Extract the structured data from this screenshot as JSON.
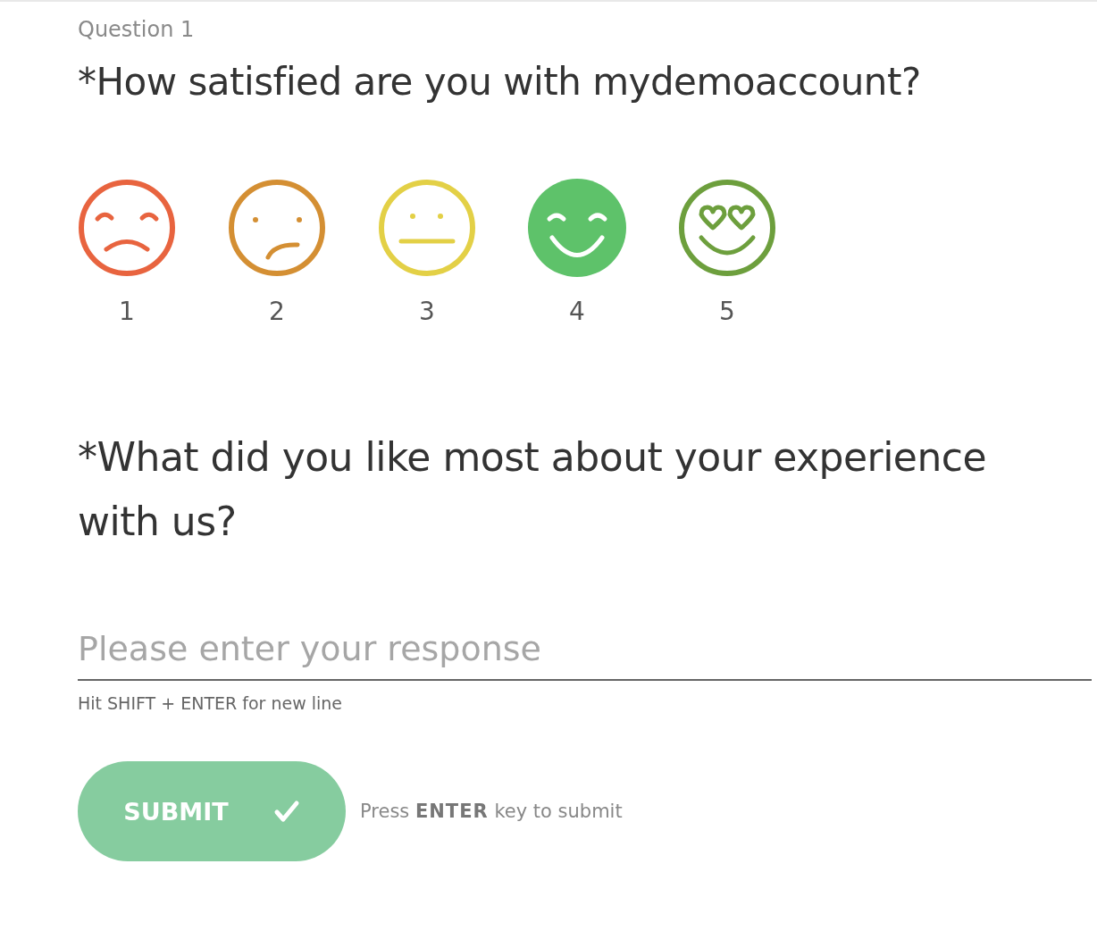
{
  "question_label": "Question 1",
  "question_1": "*How satisfied are you with mydemoaccount?",
  "ratings": [
    {
      "label": "1",
      "kind": "sad",
      "color": "#e8643f",
      "selected": false
    },
    {
      "label": "2",
      "kind": "confused",
      "color": "#d48f33",
      "selected": false
    },
    {
      "label": "3",
      "kind": "neutral",
      "color": "#e3d046",
      "selected": false
    },
    {
      "label": "4",
      "kind": "happy",
      "color": "#5ec26a",
      "selected": true
    },
    {
      "label": "5",
      "kind": "love",
      "color": "#6d9f3d",
      "selected": false
    }
  ],
  "question_2": "*What did you like most about your experience with us?",
  "response": {
    "placeholder": "Please enter your response",
    "hint": "Hit SHIFT + ENTER for new line"
  },
  "submit": {
    "label": "SUBMIT",
    "disabled": true,
    "hint": "Press **ENTER** key to submit"
  }
}
